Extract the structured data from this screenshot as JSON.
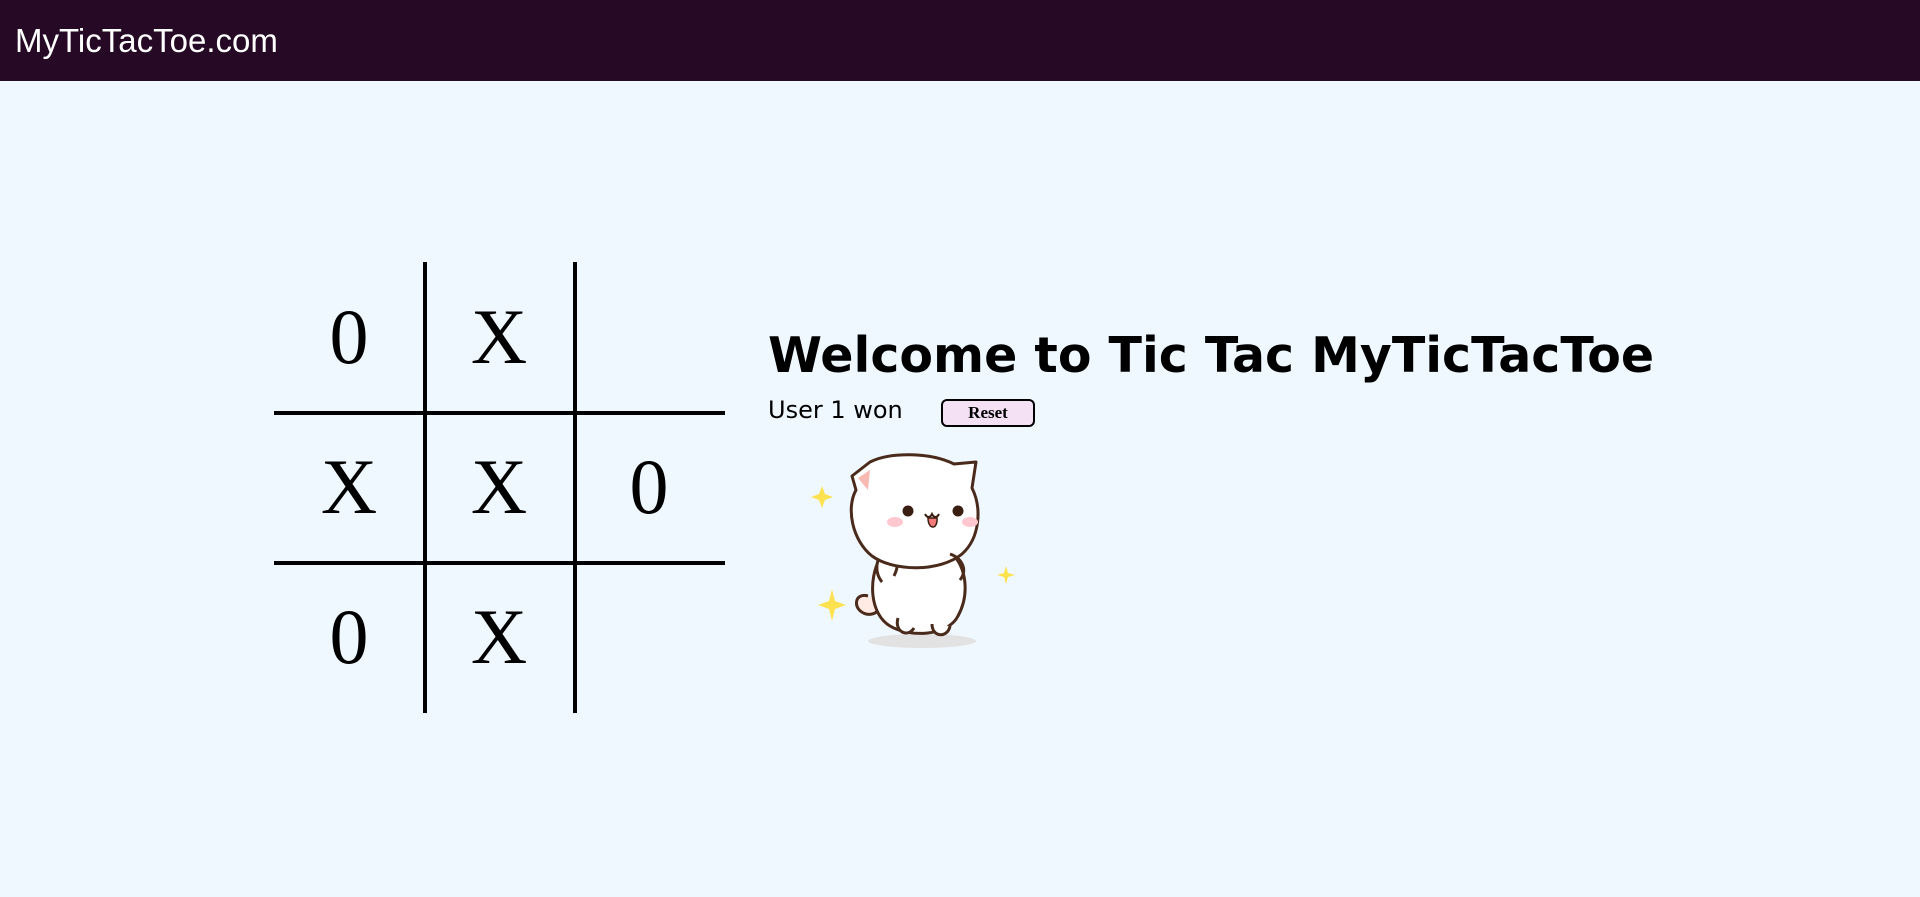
{
  "app": {
    "brand": "MyTicTacToe.com"
  },
  "board": {
    "cells": [
      "0",
      "X",
      "",
      "X",
      "X",
      "0",
      "0",
      "X",
      ""
    ]
  },
  "main": {
    "heading": "Welcome to Tic Tac MyTicTacToe",
    "status": "User 1 won",
    "reset_label": "Reset"
  },
  "colors": {
    "navbar": "#260a25",
    "background": "#f0f8ff",
    "reset_button": "#f4e1f4"
  },
  "icons": {
    "celebration": "dancing-cat-icon",
    "sparkle": "sparkle-icon"
  }
}
